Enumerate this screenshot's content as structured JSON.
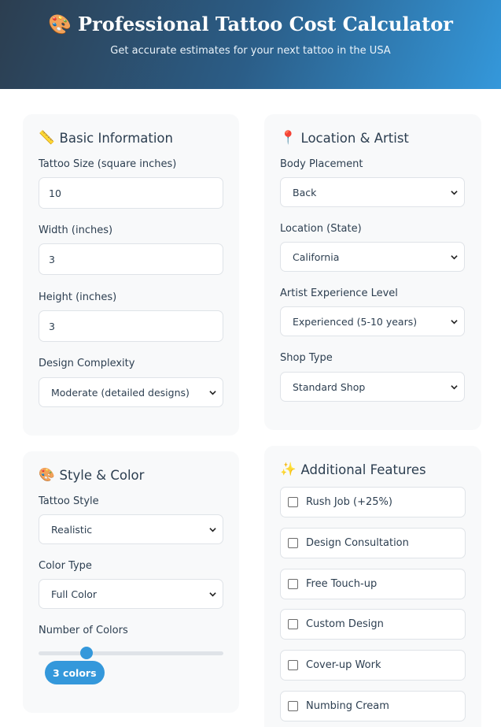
{
  "header": {
    "icon": "🎨",
    "title": "Professional Tattoo Cost Calculator",
    "subtitle": "Get accurate estimates for your next tattoo in the USA"
  },
  "basic": {
    "icon": "📏",
    "title": "Basic Information",
    "size_label": "Tattoo Size (square inches)",
    "size_value": "10",
    "width_label": "Width (inches)",
    "width_value": "3",
    "height_label": "Height (inches)",
    "height_value": "3",
    "complexity_label": "Design Complexity",
    "complexity_value": "Moderate (detailed designs)"
  },
  "location": {
    "icon": "📍",
    "title": "Location & Artist",
    "placement_label": "Body Placement",
    "placement_value": "Back",
    "state_label": "Location (State)",
    "state_value": "California",
    "experience_label": "Artist Experience Level",
    "experience_value": "Experienced (5-10 years)",
    "shop_label": "Shop Type",
    "shop_value": "Standard Shop"
  },
  "style": {
    "icon": "🎨",
    "title": "Style & Color",
    "style_label": "Tattoo Style",
    "style_value": "Realistic",
    "color_type_label": "Color Type",
    "color_type_value": "Full Color",
    "num_colors_label": "Number of Colors",
    "num_colors_badge": "3 colors",
    "num_colors_fraction": 0.243
  },
  "features": {
    "icon": "✨",
    "title": "Additional Features",
    "items": [
      {
        "label": "Rush Job (+25%)",
        "checked": false
      },
      {
        "label": "Design Consultation",
        "checked": false
      },
      {
        "label": "Free Touch-up",
        "checked": false
      },
      {
        "label": "Custom Design",
        "checked": false
      },
      {
        "label": "Cover-up Work",
        "checked": false
      },
      {
        "label": "Numbing Cream",
        "checked": false
      }
    ]
  },
  "colors": {
    "accent": "#3498db",
    "header_dark": "#2c3e50",
    "card_bg": "#f8f9fa"
  }
}
